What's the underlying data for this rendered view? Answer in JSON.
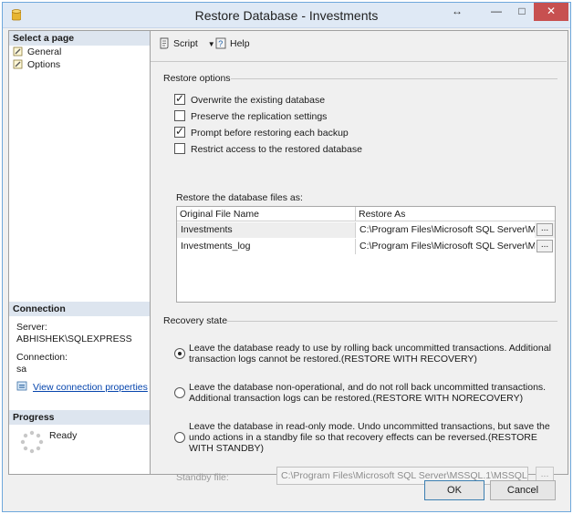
{
  "window": {
    "title": "Restore Database - Investments",
    "resize_glyph": "↔",
    "min_glyph": "—",
    "max_glyph": "□",
    "close_glyph": "✕"
  },
  "sidebar": {
    "select_page_header": "Select a page",
    "pages": [
      {
        "label": "General",
        "icon": "page-wrench-icon"
      },
      {
        "label": "Options",
        "icon": "page-wrench-icon"
      }
    ],
    "connection_header": "Connection",
    "server_label": "Server:",
    "server_value": "ABHISHEK\\SQLEXPRESS",
    "connection_label": "Connection:",
    "connection_value": "sa",
    "view_properties_link": "View connection properties",
    "progress_header": "Progress",
    "progress_status": "Ready"
  },
  "toolbar": {
    "script_label": "Script",
    "help_label": "Help"
  },
  "restore_options": {
    "header": "Restore options",
    "checkboxes": [
      {
        "label": "Overwrite the existing database",
        "checked": true
      },
      {
        "label": "Preserve the replication settings",
        "checked": false
      },
      {
        "label": "Prompt before restoring each backup",
        "checked": true
      },
      {
        "label": "Restrict access to the restored database",
        "checked": false
      }
    ],
    "files_label": "Restore the database files as:",
    "columns": [
      "Original File Name",
      "Restore As"
    ],
    "rows": [
      {
        "original": "Investments",
        "restore_as": "C:\\Program Files\\Microsoft SQL Server\\M..."
      },
      {
        "original": "Investments_log",
        "restore_as": "C:\\Program Files\\Microsoft SQL Server\\M..."
      }
    ],
    "browse_label": "..."
  },
  "recovery": {
    "header": "Recovery state",
    "options": [
      {
        "text": "Leave the database ready to use by rolling back uncommitted transactions. Additional transaction logs cannot be restored.(RESTORE WITH RECOVERY)",
        "selected": true
      },
      {
        "text": "Leave the database non-operational, and do not roll back uncommitted transactions. Additional transaction logs can be restored.(RESTORE WITH NORECOVERY)",
        "selected": false
      },
      {
        "text": "Leave the database in read-only mode. Undo uncommitted transactions, but save the undo actions in a standby file so that recovery effects can be reversed.(RESTORE WITH STANDBY)",
        "selected": false
      }
    ],
    "standby_label": "Standby file:",
    "standby_value": "C:\\Program Files\\Microsoft SQL Server\\MSSQL.1\\MSSQL\\Bac",
    "standby_browse": "..."
  },
  "buttons": {
    "ok": "OK",
    "cancel": "Cancel"
  },
  "colors": {
    "title_bar": "#dfe9f5",
    "close_button": "#c75050",
    "section_header": "#dde5ef",
    "link": "#0645ad"
  }
}
